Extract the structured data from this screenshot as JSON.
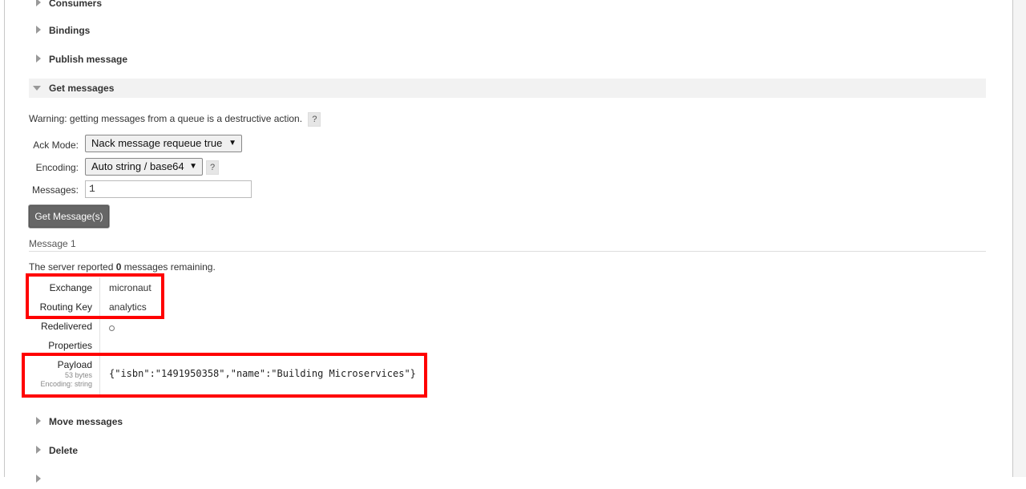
{
  "sections": {
    "consumers": "Consumers",
    "bindings": "Bindings",
    "publish": "Publish message",
    "get": "Get messages",
    "move": "Move messages",
    "delete": "Delete"
  },
  "warning": {
    "text": "Warning: getting messages from a queue is a destructive action.",
    "help": "?"
  },
  "form": {
    "ack_mode_label": "Ack Mode:",
    "ack_mode_value": "Nack message requeue true",
    "encoding_label": "Encoding:",
    "encoding_value": "Auto string / base64",
    "encoding_help": "?",
    "messages_label": "Messages:",
    "messages_value": "1",
    "button": "Get Message(s)"
  },
  "message": {
    "title": "Message 1",
    "remaining_prefix": "The server reported ",
    "remaining_count": "0",
    "remaining_suffix": " messages remaining.",
    "exchange_label": "Exchange",
    "exchange_value": "micronaut",
    "routing_key_label": "Routing Key",
    "routing_key_value": "analytics",
    "redelivered_label": "Redelivered",
    "properties_label": "Properties",
    "payload_label": "Payload",
    "payload_size": "53 bytes",
    "payload_encoding": "Encoding: string",
    "payload_value": "{\"isbn\":\"1491950358\",\"name\":\"Building Microservices\"}"
  },
  "colors": {
    "highlight": "#ff0000",
    "button_bg": "#666666"
  },
  "icons": {
    "collapsed": "triangle-right-icon",
    "expanded": "triangle-down-icon",
    "redelivered": "circle-icon"
  }
}
